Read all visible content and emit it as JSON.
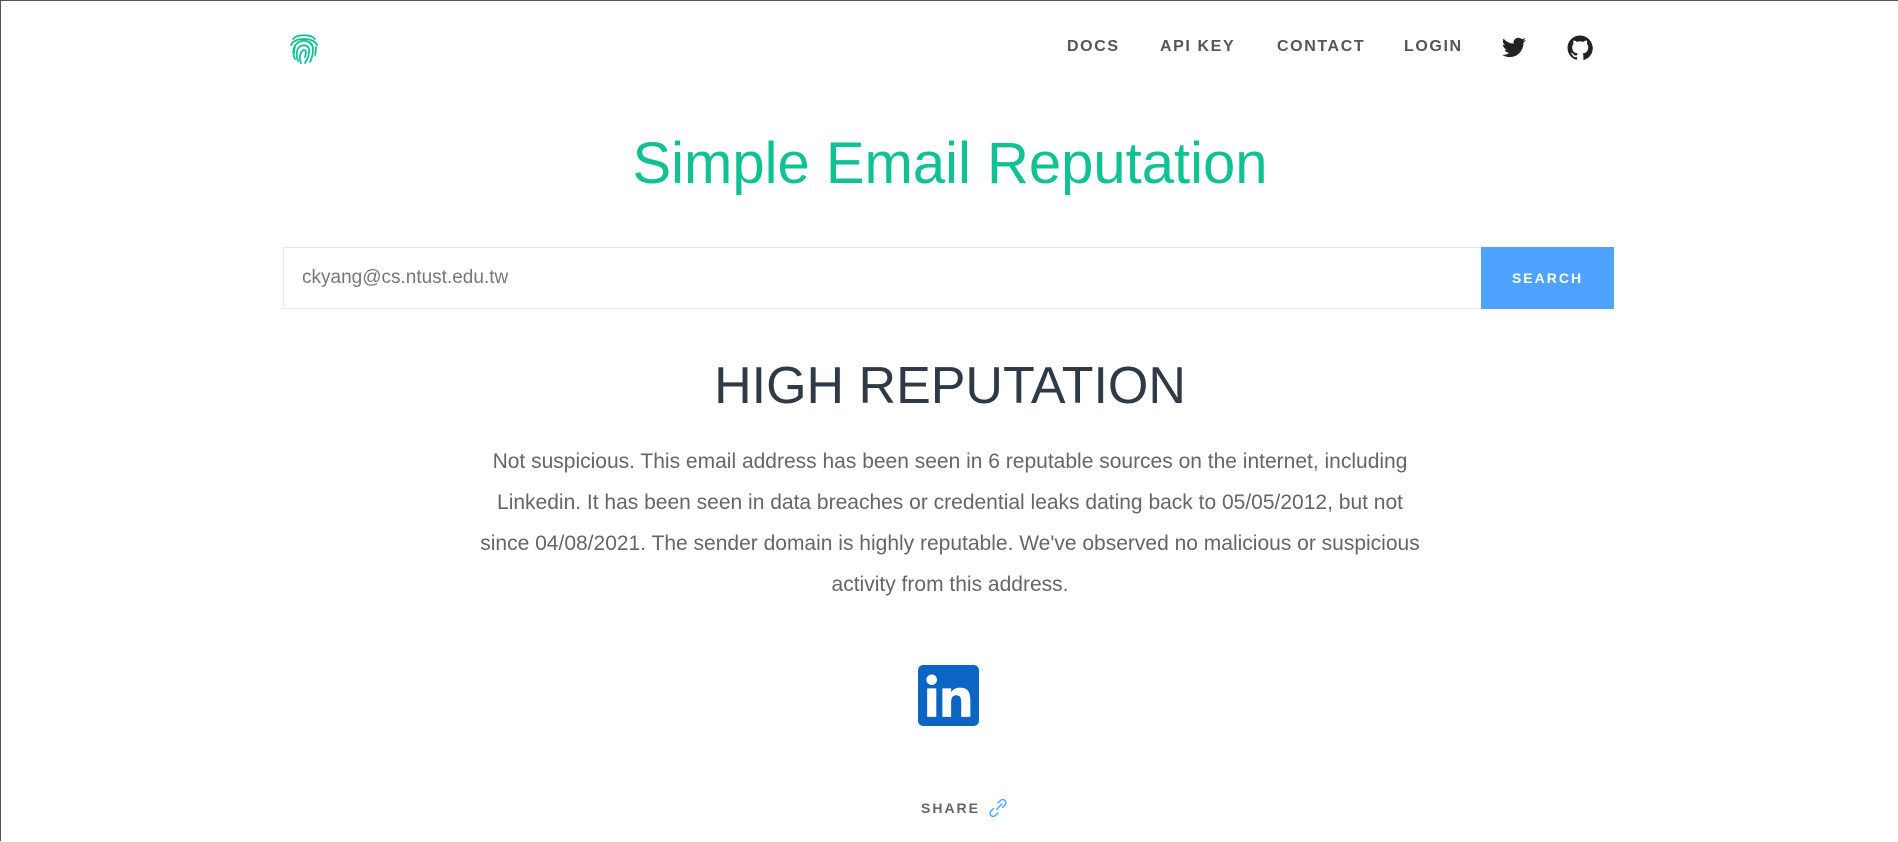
{
  "header": {
    "logo_icon": "fingerprint-icon",
    "nav": {
      "docs": "DOCS",
      "api_key": "API KEY",
      "contact": "CONTACT",
      "login": "LOGIN"
    },
    "social": [
      "twitter-icon",
      "github-icon"
    ]
  },
  "main": {
    "title": "Simple Email Reputation",
    "search": {
      "value": "ckyang@cs.ntust.edu.tw",
      "button_label": "SEARCH"
    },
    "result": {
      "heading": "HIGH REPUTATION",
      "description": "Not suspicious. This email address has been seen in 6 reputable sources on the internet, including Linkedin. It has been seen in data breaches or credential leaks dating back to 05/05/2012, but not since 04/08/2021. The sender domain is highly reputable. We've observed no malicious or suspicious activity from this address."
    },
    "sources": [
      "linkedin-icon"
    ],
    "share_label": "SHARE"
  },
  "colors": {
    "title": "#10c193",
    "button": "#4da3ff",
    "heading": "#2f3a47",
    "linkedin": "#0a66c2"
  }
}
